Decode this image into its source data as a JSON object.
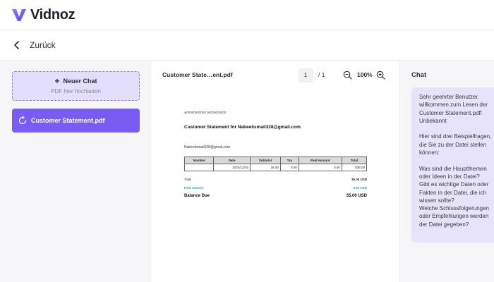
{
  "header": {
    "logo_text": "Vidnoz",
    "logo_icon": "vidnoz-v-logo"
  },
  "nav": {
    "back_label": "Zurück",
    "back_icon": "chevron-left-icon"
  },
  "sidebar": {
    "new_chat_label": "Neuer Chat",
    "upload_hint": "PDF hier hochladen",
    "chat_items": [
      {
        "label": "Customer Statement.pdf",
        "icon": "chat-refresh-icon"
      }
    ],
    "accent_color": "#7b5cf2"
  },
  "viewer": {
    "file_name": "Customer State…ent.pdf",
    "page_current": "1",
    "page_total": "/ 1",
    "zoom": "100%"
  },
  "document": {
    "email_top": "w00000000000.00000000000",
    "heading": "Customer Statement for Nabeelismail328@gmail.com",
    "email_mid": "Nabeelismail328@gmail.com",
    "table": {
      "headers": [
        "Number",
        "Date",
        "Subtotal",
        "Tax",
        "Paid Amount",
        "Total"
      ],
      "rows": [
        [
          "",
          "2024/12/16",
          "35.00",
          "0.00",
          "0.00",
          "$35.00"
        ]
      ]
    },
    "total_label": "Total",
    "total_value": "35.00 USD",
    "paid_label": "Paid Amount",
    "paid_value": "0.00 USD",
    "balance_label": "Balance Due",
    "balance_value": "35.00 USD"
  },
  "chat": {
    "title": "Chat",
    "message": "Sehr geehrter Benutzer,\nwillkommen zum Lesen der\nCustomer Statement.pdf!\nUnbekannt\n\nHier sind drei Beispielfragen,\ndie Sie zu der Datei stellen\nkönnen:\n\nWas sind die Hauptthemen\noder Ideen in der Datei?\nGibt es wichtige Daten oder\nFakten in der Datei, die ich\nwissen sollte?\nWelche Schlussfolgerungen\noder Empfehlungen werden\nder Datei gegeben?"
  }
}
